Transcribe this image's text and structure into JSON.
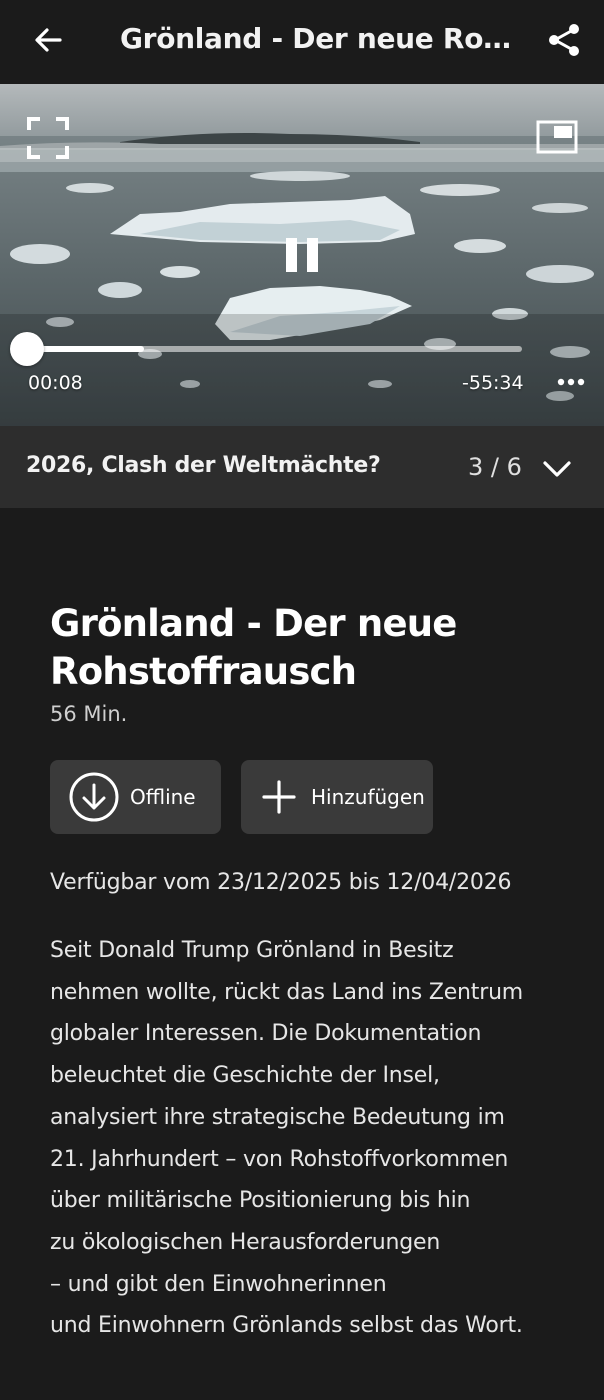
{
  "appbar": {
    "title": "Grönland - Der neue Rohst...",
    "back_icon": "arrow-left-icon",
    "share_icon": "share-icon"
  },
  "player": {
    "elapsed": "00:08",
    "remaining": "-55:34",
    "progress_fraction": 0.0024,
    "buffered_fraction": 0.235,
    "state": "playing",
    "icons": {
      "fullscreen": "fullscreen-icon",
      "pip": "picture-in-picture-icon",
      "pause": "pause-icon",
      "more": "more-dots-icon"
    }
  },
  "playlist": {
    "title": "2026, Clash der Weltmächte?",
    "position": "3 / 6",
    "chevron_icon": "chevron-down-icon"
  },
  "content": {
    "title": "Grönland - Der neue Rohstoffrausch",
    "duration": "56 Min.",
    "offline_label": "Offline",
    "add_label": "Hinzufügen",
    "availability": "Verfügbar vom 23/12/2025 bis 12/04/2026",
    "description": "Seit Donald Trump Grönland in Besitz\nnehmen wollte, rückt das Land ins Zentrum\nglobaler Interessen. Die Dokumentation\nbeleuchtet die Geschichte der Insel,\nanalysiert ihre strategische Bedeutung im\n21. Jahrhundert – von Rohstoffvorkommen\nüber militärische Positionierung bis hin\nzu ökologischen Herausforderungen\n– und gibt den Einwohnerinnen\nund Einwohnern Grönlands selbst das Wort."
  },
  "colors": {
    "background": "#1b1b1b",
    "playlist_bar": "#2d2d2d",
    "button": "#3a3a3a",
    "text": "#ffffff"
  }
}
